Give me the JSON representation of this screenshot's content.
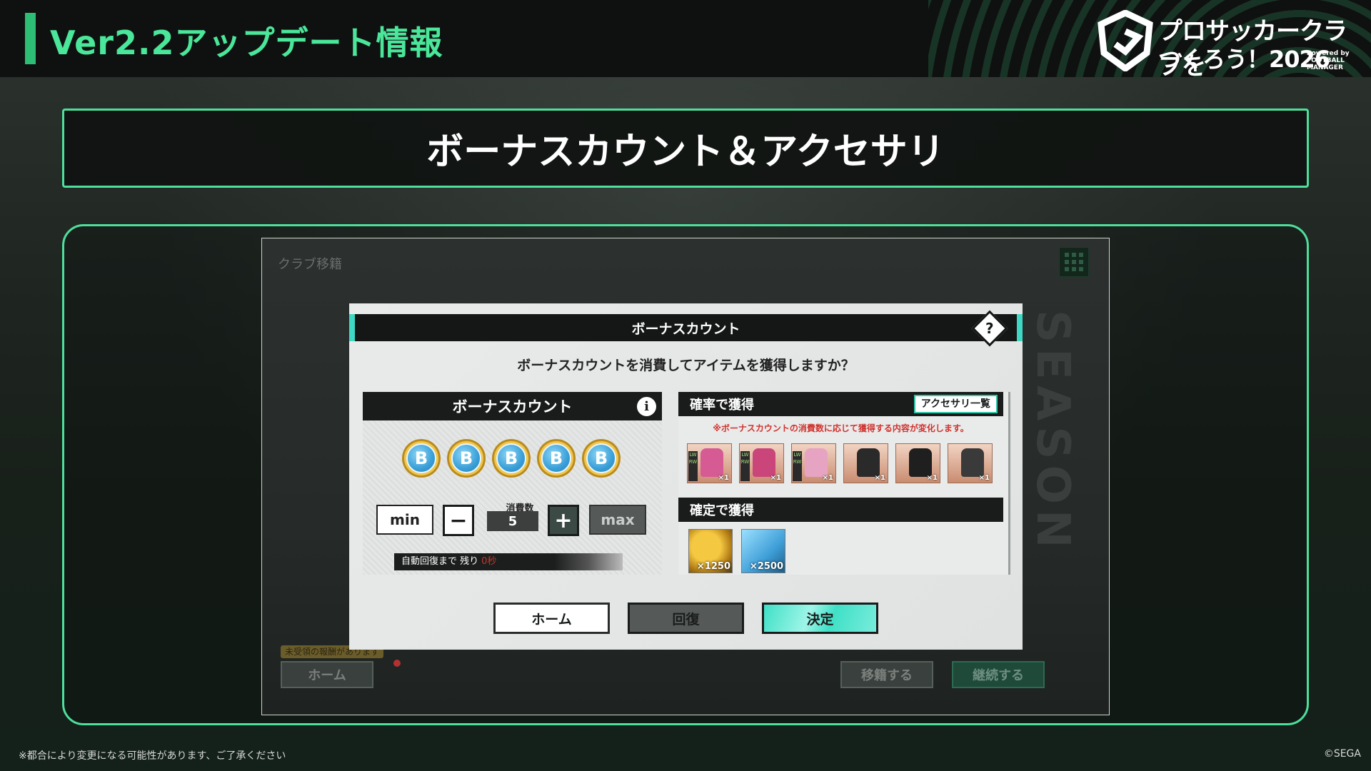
{
  "header": {
    "title": "Ver2.2アップデート情報",
    "logo_line1": "プロサッカークラブを",
    "logo_line2": "つくろう！2026",
    "logo_sub": "Powered by FOOTBALL MANAGER"
  },
  "section": {
    "title": "ボーナスカウント＆アクセサリ"
  },
  "game": {
    "screen_title": "クラブ移籍",
    "season_watermark": "SEASON",
    "notice": "未受領の報酬があります",
    "home_button": "ホーム",
    "transfer_button": "移籍する",
    "continue_button": "継続する"
  },
  "modal": {
    "title": "ボーナスカウント",
    "question": "ボーナスカウントを消費してアイテムを獲得しますか？",
    "left_panel": {
      "title": "ボーナスカウント",
      "coin_count": 5,
      "coin_letter": "B",
      "count_label": "消費数",
      "count_value": "5",
      "min_label": "min",
      "max_label": "max",
      "minus_label": "−",
      "plus_label": "+",
      "recover_text": "自動回復まで 残り",
      "recover_remaining": "0秒"
    },
    "right_panel": {
      "random_title": "確率で獲得",
      "accessory_button": "アクセサリ一覧",
      "note": "※ボーナスカウントの消費数に応じて獲得する内容が変化します。",
      "items": [
        {
          "name": "pink-jacket",
          "color": "#d65a94",
          "pos": "LW RW",
          "qty": "×1"
        },
        {
          "name": "pink-boots",
          "color": "#c9457a",
          "pos": "LW RW",
          "qty": "×1"
        },
        {
          "name": "pink-headband",
          "color": "#e6a4c2",
          "pos": "LW RW",
          "qty": "×1"
        },
        {
          "name": "black-shirt",
          "color": "#2a2a2a",
          "pos": "",
          "qty": "×1"
        },
        {
          "name": "black-shorts",
          "color": "#1f1f1f",
          "pos": "",
          "qty": "×1"
        },
        {
          "name": "black-headband",
          "color": "#3a3a3a",
          "pos": "",
          "qty": "×1"
        }
      ],
      "fixed_title": "確定で獲得",
      "rewards": [
        {
          "type": "gold",
          "qty": "×1250"
        },
        {
          "type": "blue",
          "qty": "×2500"
        }
      ]
    },
    "buttons": {
      "home": "ホーム",
      "recover": "回復",
      "confirm": "決定"
    }
  },
  "footer": {
    "note": "※都合により変更になる可能性があります、ご了承ください",
    "copyright": "©SEGA"
  }
}
